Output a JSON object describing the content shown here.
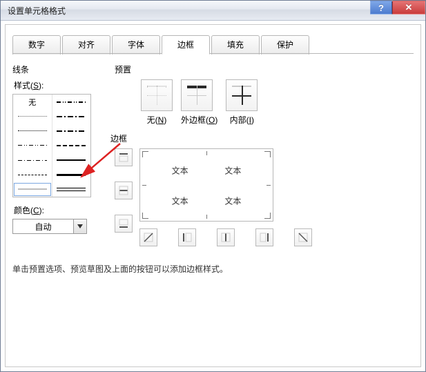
{
  "window": {
    "title": "设置单元格格式",
    "help_symbol": "?",
    "close_symbol": "✕"
  },
  "tabs": [
    {
      "label": "数字"
    },
    {
      "label": "对齐"
    },
    {
      "label": "字体"
    },
    {
      "label": "边框",
      "active": true
    },
    {
      "label": "填充"
    },
    {
      "label": "保护"
    }
  ],
  "left": {
    "section": "线条",
    "style_label_pre": "样式(",
    "style_label_key": "S",
    "style_label_post": "):",
    "none_text": "无",
    "color_label_pre": "颜色(",
    "color_label_key": "C",
    "color_label_post": "):",
    "color_value": "自动"
  },
  "right": {
    "preset_section": "预置",
    "presets": {
      "none": {
        "label_pre": "无(",
        "key": "N",
        "label_post": ")"
      },
      "outline": {
        "label_pre": "外边框(",
        "key": "O",
        "label_post": ")"
      },
      "inside": {
        "label_pre": "内部(",
        "key": "I",
        "label_post": ")"
      }
    },
    "border_section": "边框",
    "preview_text": "文本"
  },
  "hint": "单击预置选项、预览草图及上面的按钮可以添加边框样式。"
}
